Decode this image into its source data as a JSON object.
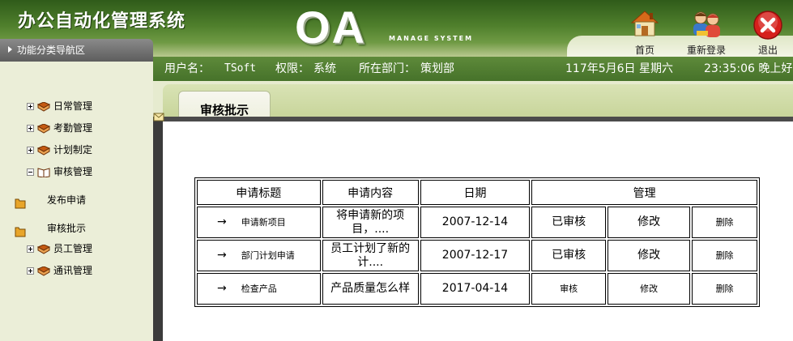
{
  "header": {
    "system_title": "办公自动化管理系统",
    "logo_text": "OA",
    "logo_subtitle": "MANAGE SYSTEM",
    "buttons": {
      "home": "首页",
      "relogin": "重新登录",
      "exit": "退出"
    }
  },
  "nav": {
    "title": "功能分类导航区"
  },
  "userbar": {
    "username_label": "用户名：",
    "username": "TSoft",
    "permission_label": "权限：",
    "permission": "系统",
    "department_label": "所在部门：",
    "department": "策划部",
    "date": "117年5月6日 星期六",
    "time": "23:35:06 晚上好"
  },
  "sidebar": {
    "items": [
      {
        "label": "日常管理"
      },
      {
        "label": "考勤管理"
      },
      {
        "label": "计划制定"
      },
      {
        "label": "审核管理"
      }
    ],
    "sub_items": [
      {
        "label": "发布申请"
      },
      {
        "label": "审核批示"
      }
    ],
    "bottom_items": [
      {
        "label": "员工管理"
      },
      {
        "label": "通讯管理"
      }
    ]
  },
  "main": {
    "tab_label": "审核批示",
    "table": {
      "headers": {
        "title": "申请标题",
        "content": "申请内容",
        "date": "日期",
        "manage": "管理"
      },
      "rows": [
        {
          "arrow": "→",
          "title": "申请新项目",
          "content": "将申请新的项目，....",
          "date": "2007-12-14",
          "status": "已审核",
          "edit": "修改",
          "delete": "删除"
        },
        {
          "arrow": "→",
          "title": "部门计划申请",
          "content": "员工计划了新的计....",
          "date": "2007-12-17",
          "status": "已审核",
          "edit": "修改",
          "delete": "删除"
        },
        {
          "arrow": "→",
          "title": "检查产品",
          "content": "产品质量怎么样",
          "date": "2017-04-14",
          "status": "审核",
          "edit": "修改",
          "delete": "删除"
        }
      ]
    }
  },
  "icons": {
    "home": "house-icon",
    "relogin": "users-icon",
    "exit": "close-icon",
    "book": "book-icon",
    "folder": "folder-icon"
  },
  "colors": {
    "header_green": "#4f7f2c",
    "sidebar_bg": "#ebeed8",
    "tab_strip": "#c8d59b",
    "exit_red": "#d6201c"
  }
}
